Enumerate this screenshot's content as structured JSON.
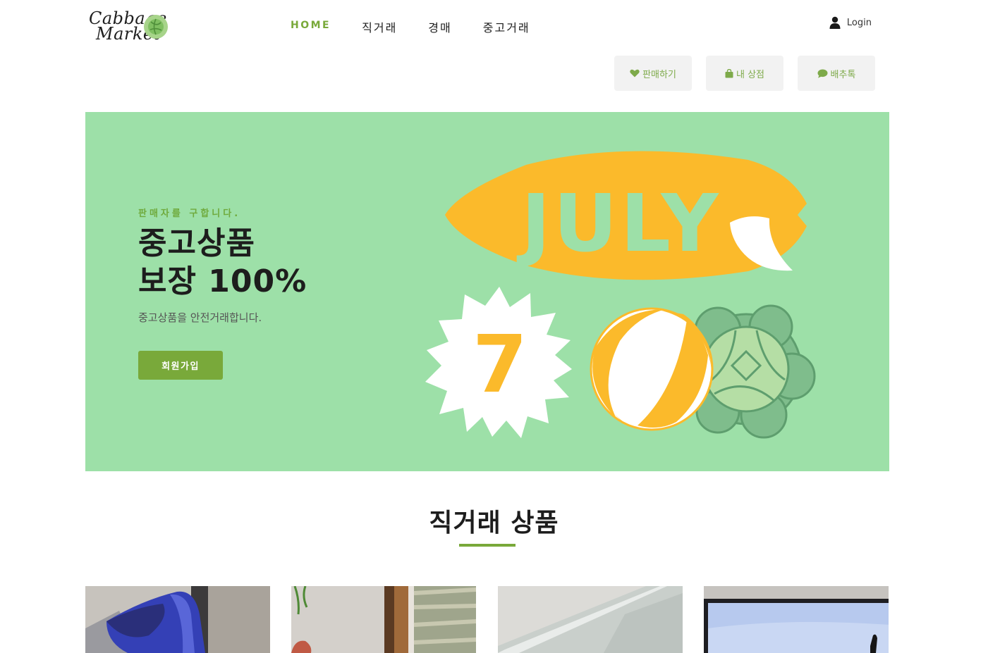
{
  "logo": {
    "line1": "Cabbage",
    "line2": "Market"
  },
  "nav": {
    "items": [
      {
        "label": "HOME",
        "active": true
      },
      {
        "label": "직거래",
        "active": false
      },
      {
        "label": "경매",
        "active": false
      },
      {
        "label": "중고거래",
        "active": false
      }
    ]
  },
  "user": {
    "login_label": "Login",
    "icon": "user-icon"
  },
  "quick_buttons": [
    {
      "label": "판매하기",
      "icon": "heart-icon"
    },
    {
      "label": "내 상점",
      "icon": "shopping-bag-icon"
    },
    {
      "label": "배추톡",
      "icon": "chat-icon"
    }
  ],
  "hero": {
    "subtitle": "판매자를 구합니다.",
    "title_line1": "중고상품",
    "title_line2": "보장 100%",
    "description": "중고상품을 안전거래합니다.",
    "cta_label": "회원가입",
    "banner_word": "JULY",
    "banner_number": "7",
    "background_color": "#9de0a8",
    "accent_color": "#fbba2b"
  },
  "products_section": {
    "title": "직거래 상품",
    "accent_color": "#79a93a"
  },
  "colors": {
    "brand_green": "#79a93a",
    "button_bg": "#f2f2f2"
  }
}
